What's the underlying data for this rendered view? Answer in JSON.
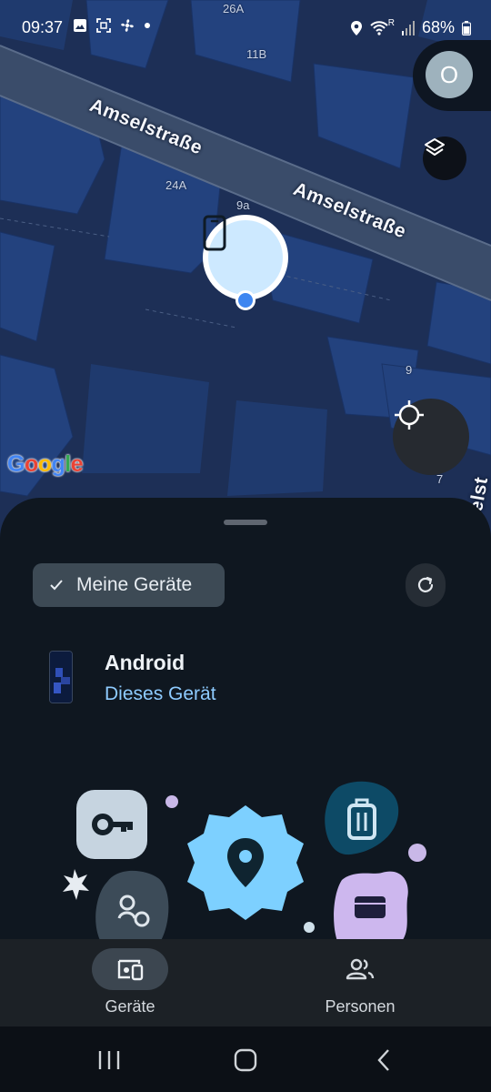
{
  "status_bar": {
    "time": "09:37",
    "battery": "68%",
    "icons_left": [
      "image-icon",
      "screenshot-icon",
      "fan-icon",
      "dot-icon"
    ],
    "icons_right": [
      "location-icon",
      "wifi-icon",
      "signal-icon",
      "battery-icon"
    ],
    "wifi_tag": "R"
  },
  "map": {
    "street_name": "Amselstraße",
    "street_name_2": "Amselstraße",
    "street_fragment": "elst",
    "house_numbers": [
      "26A",
      "11B",
      "24A",
      "9a",
      "9",
      "7"
    ],
    "logo_letters": [
      "G",
      "o",
      "o",
      "g",
      "l",
      "e"
    ],
    "avatar_initial": "O"
  },
  "sheet": {
    "filter_label": "Meine Geräte",
    "device": {
      "name": "Android",
      "status": "Dieses Gerät"
    }
  },
  "nav": {
    "devices_label": "Geräte",
    "people_label": "Personen"
  },
  "colors": {
    "accent": "#8ecbff",
    "pin_fill": "#cde9ff",
    "location_dot": "#3e86f0"
  }
}
